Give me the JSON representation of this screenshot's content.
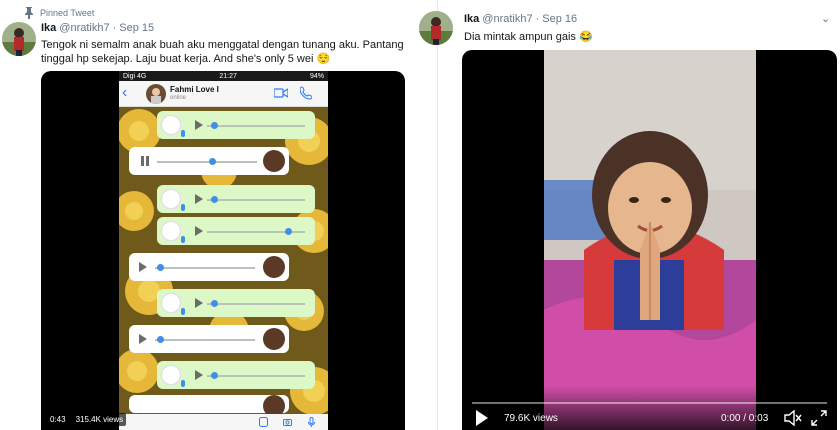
{
  "left_tweet": {
    "pinned_label": "Pinned Tweet",
    "name": "Ika",
    "handle": "@nratikh7",
    "separator": "·",
    "date": "Sep 15",
    "text": "Tengok ni semalm anak buah aku menggatal dengan tunang aku. Pantang tinggal hp sekejap. Laju buat kerja. And she's only 5 wei 😌",
    "caret": "⌄",
    "video": {
      "duration": "0:43",
      "views": "315.4K views"
    },
    "phone": {
      "carrier": "Digi 4G",
      "clock": "21:27",
      "battery": "94%",
      "back": "‹",
      "contact_name": "Fahmi Love I",
      "contact_status": "online"
    }
  },
  "right_tweet": {
    "name": "Ika",
    "handle": "@nratikh7",
    "separator": "·",
    "date": "Sep 16",
    "text": "Dia mintak ampun gais 😂",
    "caret": "⌄",
    "video": {
      "views": "79.6K views",
      "time": "0:00 / 0:03"
    }
  }
}
